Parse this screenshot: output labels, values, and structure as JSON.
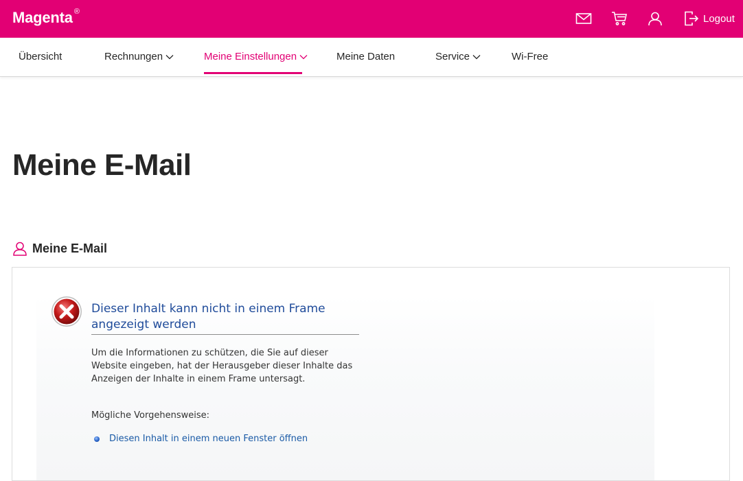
{
  "header": {
    "brand": "Magenta",
    "brand_mark": "®",
    "icons": [
      "mail-icon",
      "cart-icon",
      "user-icon",
      "logout-icon"
    ],
    "logout_label": "Logout",
    "bg_color": "#e20074"
  },
  "nav": {
    "items": [
      {
        "label": "Übersicht",
        "has_dropdown": false,
        "active": false
      },
      {
        "label": "Rechnungen",
        "has_dropdown": true,
        "active": false
      },
      {
        "label": "Meine Einstellungen",
        "has_dropdown": true,
        "active": true
      },
      {
        "label": "Meine Daten",
        "has_dropdown": false,
        "active": false
      },
      {
        "label": "Service",
        "has_dropdown": true,
        "active": false
      },
      {
        "label": "Wi-Free",
        "has_dropdown": false,
        "active": false
      }
    ],
    "accent_color": "#e20074"
  },
  "main": {
    "title": "Meine E-Mail",
    "section": {
      "icon": "user-icon",
      "label": "Meine E-Mail"
    },
    "frame_error": {
      "icon": "error-icon",
      "title": "Dieser Inhalt kann nicht in einem Frame angezeigt werden",
      "body": "Um die Informationen zu schützen, die Sie auf dieser Website eingeben, hat der Herausgeber dieser Inhalte das Anzeigen der Inhalte in einem Frame untersagt.",
      "actions_heading": "Mögliche Vorgehensweise:",
      "link_label": "Diesen Inhalt in einem neuen Fenster öffnen",
      "title_color": "#1f4b9a",
      "link_color": "#1a5aa6"
    }
  }
}
